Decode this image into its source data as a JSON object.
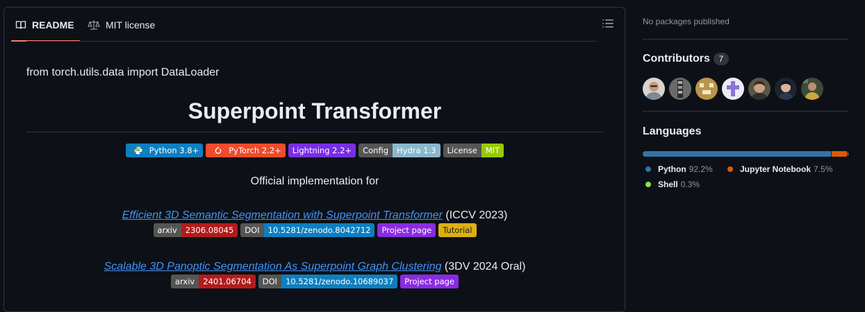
{
  "readme": {
    "tabs": [
      {
        "label": "README",
        "icon": "book-icon",
        "active": true
      },
      {
        "label": "MIT license",
        "icon": "law-icon",
        "active": false
      }
    ],
    "code_line": "from torch.utils.data import DataLoader",
    "title": "Superpoint Transformer",
    "badges": [
      {
        "left": "",
        "right": "Python 3.8+",
        "color": "#0e7fc0",
        "icon": "python-icon"
      },
      {
        "left": "",
        "right": "PyTorch 2.2+",
        "color": "#ee4c2c",
        "icon": "pytorch-icon"
      },
      {
        "left": "",
        "right": "Lightning 2.2+",
        "color": "#792ee5",
        "icon": ""
      },
      {
        "left": "Config",
        "right": "Hydra 1.3",
        "color": "#89b8cd",
        "icon": ""
      },
      {
        "left": "License",
        "right": "MIT",
        "color": "#97ca00",
        "icon": ""
      }
    ],
    "official": "Official implementation for",
    "papers": [
      {
        "link": "Efficient 3D Semantic Segmentation with Superpoint Transformer",
        "venue": " (ICCV 2023)",
        "badges": [
          {
            "left": "arxiv",
            "right": "2306.08045",
            "color": "#b31b1b"
          },
          {
            "left": "DOI",
            "right": "10.5281/zenodo.8042712",
            "color": "#0d7fc0"
          },
          {
            "left": "",
            "right": "Project page",
            "color": "#8a2be2"
          },
          {
            "left": "",
            "right": "Tutorial",
            "color": "#ddb012"
          }
        ]
      },
      {
        "link": "Scalable 3D Panoptic Segmentation As Superpoint Graph Clustering",
        "venue": " (3DV 2024 Oral)",
        "badges": [
          {
            "left": "arxiv",
            "right": "2401.06704",
            "color": "#b31b1b"
          },
          {
            "left": "DOI",
            "right": "10.5281/zenodo.10689037",
            "color": "#0d7fc0"
          },
          {
            "left": "",
            "right": "Project page",
            "color": "#8a2be2"
          }
        ]
      }
    ]
  },
  "sidebar": {
    "packages_text": "No packages published",
    "contributors": {
      "title": "Contributors",
      "count": "7",
      "avatars": [
        "contributor-1",
        "contributor-2",
        "contributor-3",
        "contributor-4",
        "contributor-5",
        "contributor-6",
        "contributor-7"
      ]
    },
    "languages": {
      "title": "Languages",
      "items": [
        {
          "name": "Python",
          "percent": "92.2%",
          "share": 92.2,
          "color": "#3572a5"
        },
        {
          "name": "Jupyter Notebook",
          "percent": "7.5%",
          "share": 7.5,
          "color": "#da5b0b"
        },
        {
          "name": "Shell",
          "percent": "0.3%",
          "share": 0.3,
          "color": "#89e051"
        }
      ]
    }
  }
}
